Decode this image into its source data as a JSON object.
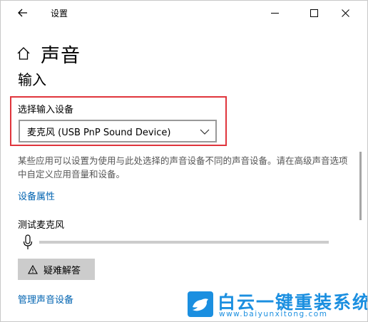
{
  "window": {
    "title": "设置"
  },
  "header": {
    "title": "声音"
  },
  "section": {
    "title": "输入"
  },
  "input_device": {
    "label": "选择输入设备",
    "selected": "麦克风 (USB PnP Sound Device)"
  },
  "description": "某些应用可以设置为使用与此处选择的声音设备不同的声音设备。请在高级声音选项中自定义应用音量和设备。",
  "links": {
    "device_properties": "设备属性",
    "manage_devices": "管理声音设备"
  },
  "mic_test": {
    "label": "测试麦克风",
    "level": 0
  },
  "troubleshoot": {
    "label": "疑难解答"
  },
  "watermark": {
    "text": "白云一键重装系统",
    "url": "www.baiyunxitong.com"
  },
  "colors": {
    "accent": "#0063b1",
    "highlight": "#e0353c",
    "watermark": "#1b8fe0"
  },
  "icons": [
    "back-arrow-icon",
    "minimize-icon",
    "maximize-icon",
    "close-icon",
    "home-icon",
    "chevron-down-icon",
    "microphone-icon",
    "warning-icon",
    "bird-logo-icon"
  ]
}
